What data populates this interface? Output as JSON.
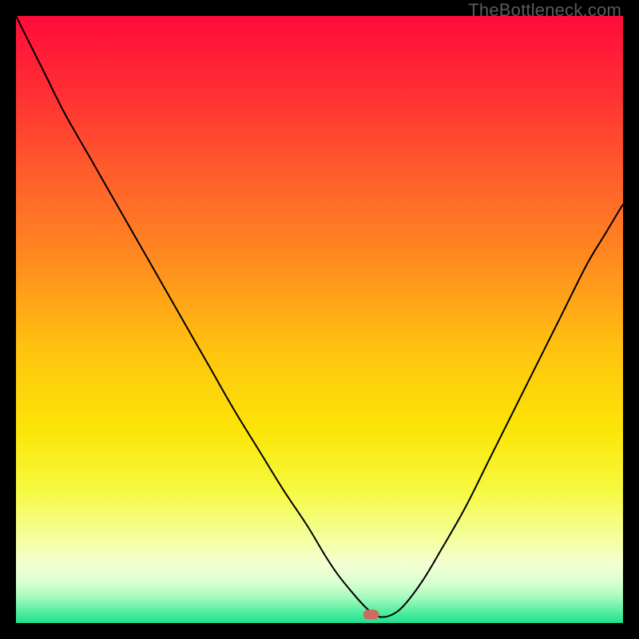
{
  "watermark": "TheBottleneck.com",
  "chart_data": {
    "type": "line",
    "title": "",
    "xlabel": "",
    "ylabel": "",
    "xlim": [
      0,
      100
    ],
    "ylim": [
      0,
      100
    ],
    "grid": false,
    "legend": false,
    "background_gradient": [
      {
        "offset": 0.0,
        "color": "#ff0b3a"
      },
      {
        "offset": 0.12,
        "color": "#ff2d34"
      },
      {
        "offset": 0.25,
        "color": "#ff5a2c"
      },
      {
        "offset": 0.4,
        "color": "#ff8a1f"
      },
      {
        "offset": 0.55,
        "color": "#ffc30f"
      },
      {
        "offset": 0.68,
        "color": "#fbe506"
      },
      {
        "offset": 0.78,
        "color": "#f6f93f"
      },
      {
        "offset": 0.86,
        "color": "#f4ff9d"
      },
      {
        "offset": 0.905,
        "color": "#f3ffd4"
      },
      {
        "offset": 0.935,
        "color": "#d6ffcf"
      },
      {
        "offset": 0.958,
        "color": "#a5fabc"
      },
      {
        "offset": 0.978,
        "color": "#5ef0a3"
      },
      {
        "offset": 1.0,
        "color": "#1fe091"
      }
    ],
    "series": [
      {
        "name": "bottleneck-curve",
        "color": "#000000",
        "width": 2,
        "x": [
          0,
          2,
          5,
          8,
          12,
          16,
          20,
          24,
          28,
          32,
          36,
          40,
          44,
          48,
          51,
          53,
          55,
          57,
          58.5,
          60,
          62,
          64,
          67,
          70,
          74,
          78,
          82,
          86,
          90,
          94,
          97,
          100
        ],
        "y": [
          100,
          96,
          90,
          84,
          77,
          70,
          63,
          56,
          49,
          42,
          35,
          28.5,
          22,
          16,
          11,
          8,
          5.5,
          3.2,
          1.8,
          1.0,
          1.4,
          3.0,
          7,
          12,
          19,
          27,
          35,
          43,
          51,
          59,
          64,
          69
        ]
      }
    ],
    "marker": {
      "x": 58.5,
      "y": 1.4,
      "shape": "rounded-rect",
      "color": "#cf6a61",
      "width": 2.6,
      "height": 1.6
    }
  }
}
